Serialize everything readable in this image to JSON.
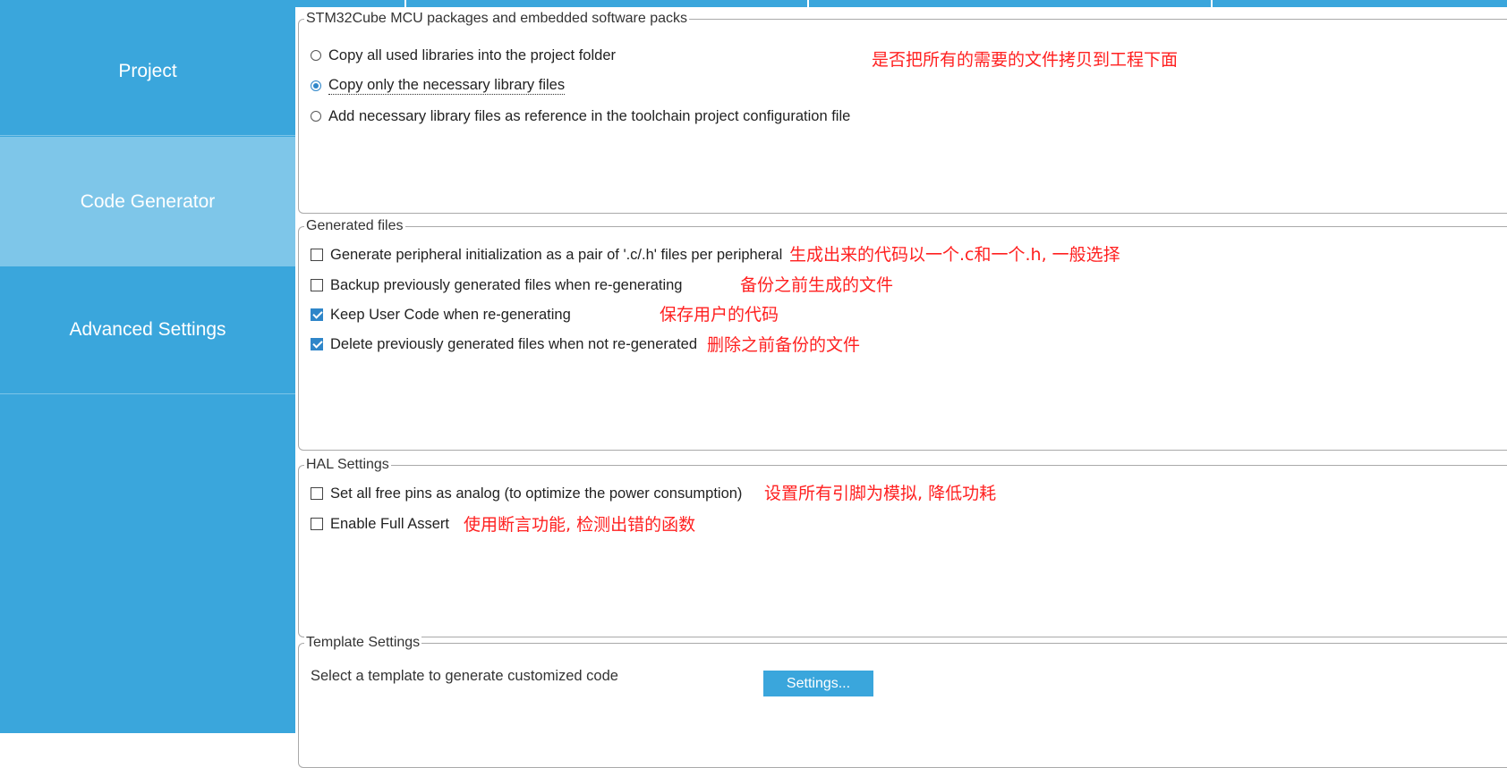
{
  "sidebar": {
    "items": [
      {
        "label": "Project"
      },
      {
        "label": "Code Generator"
      },
      {
        "label": "Advanced Settings"
      }
    ]
  },
  "packages": {
    "legend": "STM32Cube MCU packages and embedded software packs",
    "options": [
      {
        "label": "Copy all used libraries into the project folder",
        "selected": false
      },
      {
        "label": "Copy only the necessary library files",
        "selected": true
      },
      {
        "label": "Add necessary library files as reference in the toolchain project configuration file",
        "selected": false
      }
    ],
    "note": "是否把所有的需要的文件拷贝到工程下面"
  },
  "generated": {
    "legend": "Generated files",
    "options": [
      {
        "label": "Generate peripheral initialization as a pair of '.c/.h' files per peripheral",
        "checked": false,
        "note": "生成出来的代码以一个.c和一个.h, 一般选择"
      },
      {
        "label": "Backup previously generated files when re-generating",
        "checked": false,
        "note": "备份之前生成的文件"
      },
      {
        "label": "Keep User Code when re-generating",
        "checked": true,
        "note": "保存用户的代码"
      },
      {
        "label": "Delete previously generated files when not re-generated",
        "checked": true,
        "note": "删除之前备份的文件"
      }
    ]
  },
  "hal": {
    "legend": "HAL Settings",
    "options": [
      {
        "label": "Set all free pins as analog (to optimize the power consumption)",
        "checked": false,
        "note": "设置所有引脚为模拟, 降低功耗"
      },
      {
        "label": "Enable Full Assert",
        "checked": false,
        "note": "使用断言功能, 检测出错的函数"
      }
    ]
  },
  "template": {
    "legend": "Template Settings",
    "text": "Select a template to generate customized code",
    "button_label": "Settings..."
  },
  "colors": {
    "sidebar": "#3aa6dc",
    "sidebar_active": "#7ec6e9",
    "accent": "#2f86c9",
    "note": "#ff2020"
  }
}
